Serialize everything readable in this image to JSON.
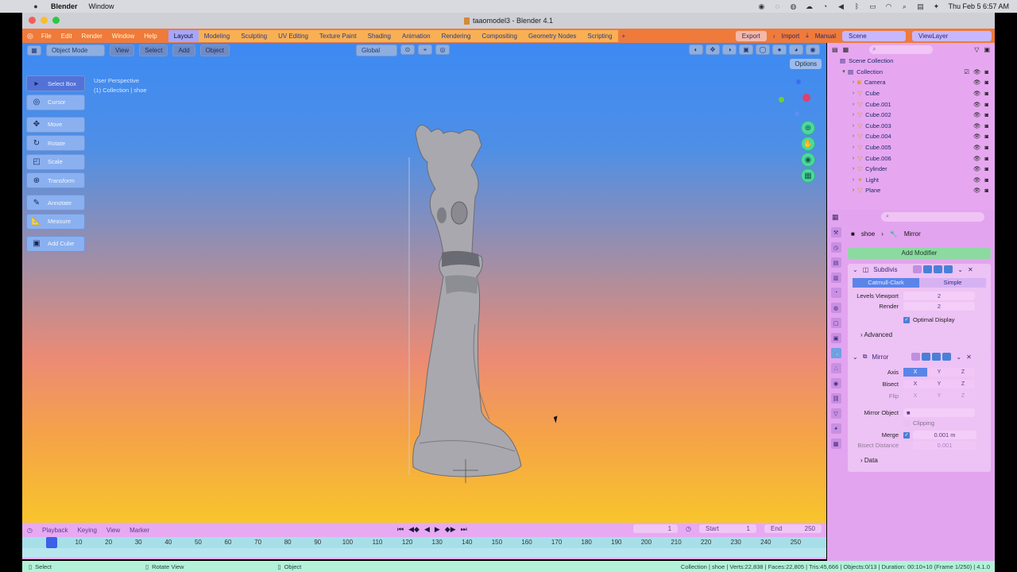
{
  "mac_menubar": {
    "apple_icon": "apple-icon",
    "app_name": "Blender",
    "menu_window": "Window",
    "clock": "Thu Feb 5  6:57 AM"
  },
  "window": {
    "title": "taaomodel3 - Blender 4.1"
  },
  "topbar": {
    "menus": [
      "File",
      "Edit",
      "Render",
      "Window",
      "Help"
    ],
    "workspaces": [
      "Layout",
      "Modeling",
      "Sculpting",
      "UV Editing",
      "Texture Paint",
      "Shading",
      "Animation",
      "Rendering",
      "Compositing",
      "Geometry Nodes",
      "Scripting"
    ],
    "active_workspace": "Layout",
    "export": "Export",
    "import": "Import",
    "manual": "Manual",
    "scene": "Scene",
    "viewlayer": "ViewLayer"
  },
  "viewport": {
    "mode": "Object Mode",
    "menus": [
      "View",
      "Select",
      "Add",
      "Object"
    ],
    "transform_orientation": "Global",
    "options": "Options",
    "info_line1": "User Perspective",
    "info_line2": "(1) Collection | shoe",
    "tools": [
      "Select Box",
      "Cursor",
      "Move",
      "Rotate",
      "Scale",
      "Transform",
      "Annotate",
      "Measure",
      "Add Cube"
    ],
    "active_tool": "Select Box"
  },
  "timeline": {
    "menus": [
      "Playback",
      "Keying",
      "View",
      "Marker"
    ],
    "current_frame": "1",
    "start_label": "Start",
    "start_value": "1",
    "end_label": "End",
    "end_value": "250",
    "ticks": [
      "10",
      "20",
      "30",
      "40",
      "50",
      "60",
      "70",
      "80",
      "90",
      "100",
      "110",
      "120",
      "130",
      "140",
      "150",
      "160",
      "170",
      "180",
      "190",
      "200",
      "210",
      "220",
      "230",
      "240",
      "250"
    ],
    "playhead": "1"
  },
  "statusbar": {
    "select": "Select",
    "rotate_view": "Rotate View",
    "object": "Object",
    "stats": "Collection | shoe | Verts:22,838 | Faces:22,805 | Tris:45,666 | Objects:0/13 | Duration: 00:10+10 (Frame 1/250) | 4.1.0"
  },
  "outliner": {
    "scene_collection": "Scene Collection",
    "collection": "Collection",
    "items": [
      "Camera",
      "Cube",
      "Cube.001",
      "Cube.002",
      "Cube.003",
      "Cube.004",
      "Cube.005",
      "Cube.006",
      "Cylinder",
      "Light",
      "Plane"
    ],
    "hidden_item": "Plane",
    "last_item": "Plane"
  },
  "properties": {
    "object_name": "shoe",
    "modifier_name": "Mirror",
    "add_modifier": "Add Modifier",
    "subdiv": {
      "name": "Subdivis",
      "tab_catmull": "Catmull-Clark",
      "tab_simple": "Simple",
      "levels_label": "Levels Viewport",
      "levels_value": "2",
      "render_label": "Render",
      "render_value": "2",
      "optimal": "Optimal Display",
      "advanced": "Advanced"
    },
    "mirror": {
      "name": "Mirror",
      "axis_label": "Axis",
      "bisect_label": "Bisect",
      "flip_label": "Flip",
      "axes": [
        "X",
        "Y",
        "Z"
      ],
      "mirror_object_label": "Mirror Object",
      "clipping": "Clipping",
      "merge_label": "Merge",
      "merge_value": "0.001 m",
      "bisect_distance_label": "Bisect Distance",
      "bisect_distance_value": "0.001",
      "data": "Data"
    }
  },
  "colors": {
    "viewport_top": "#3d8af3",
    "viewport_bottom": "#f8c52c",
    "topbar": "#f07a3a",
    "panel": "#e6a7f0",
    "status": "#b2f2d8"
  }
}
